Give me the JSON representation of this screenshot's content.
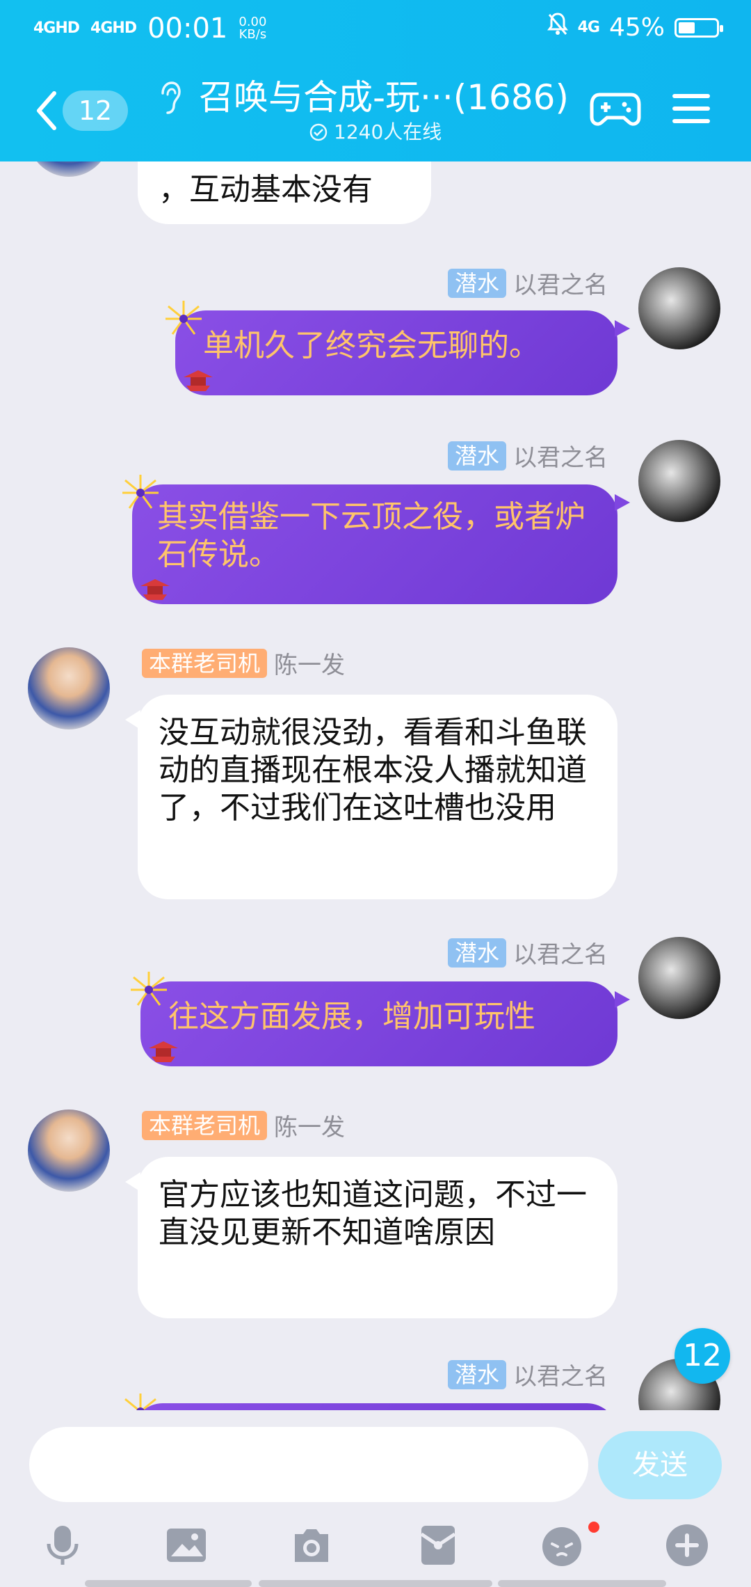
{
  "status": {
    "net1": "4GHD",
    "net2": "4GHD",
    "time": "00:01",
    "speed_value": "0.00",
    "speed_unit": "KB/s",
    "net_right": "4G",
    "battery": "45%",
    "battery_level": 0.45
  },
  "header": {
    "back_count": "12",
    "title": "召唤与合成-玩···(1686)",
    "online": "1240人在线"
  },
  "messages": [
    {
      "side": "left",
      "text": "，互动基本没有"
    },
    {
      "side": "right",
      "tag": "潜水",
      "name": "以君之名",
      "text": "单机久了终究会无聊的。"
    },
    {
      "side": "right",
      "tag": "潜水",
      "name": "以君之名",
      "text": "其实借鉴一下云顶之役，或者炉石传说。"
    },
    {
      "side": "left",
      "tag": "本群老司机",
      "name": "陈一发",
      "text": "没互动就很没劲，看看和斗鱼联动的直播现在根本没人播就知道了，不过我们在这吐槽也没用"
    },
    {
      "side": "right",
      "tag": "潜水",
      "name": "以君之名",
      "text": "往这方面发展，增加可玩性"
    },
    {
      "side": "left",
      "tag": "本群老司机",
      "name": "陈一发",
      "text": "官方应该也知道这问题，不过一直没见更新不知道啥原因"
    },
    {
      "side": "right",
      "tag": "潜水",
      "name": "以君之名",
      "text": ""
    }
  ],
  "new_count": "12",
  "composer": {
    "placeholder": "",
    "send_label": "发送"
  },
  "colors": {
    "header": "#12c0f0",
    "purple_bubble": "#7f46e0",
    "purple_text": "#ffc46a",
    "tag_blue": "#8fc1f2",
    "tag_orange": "#ffad73"
  }
}
